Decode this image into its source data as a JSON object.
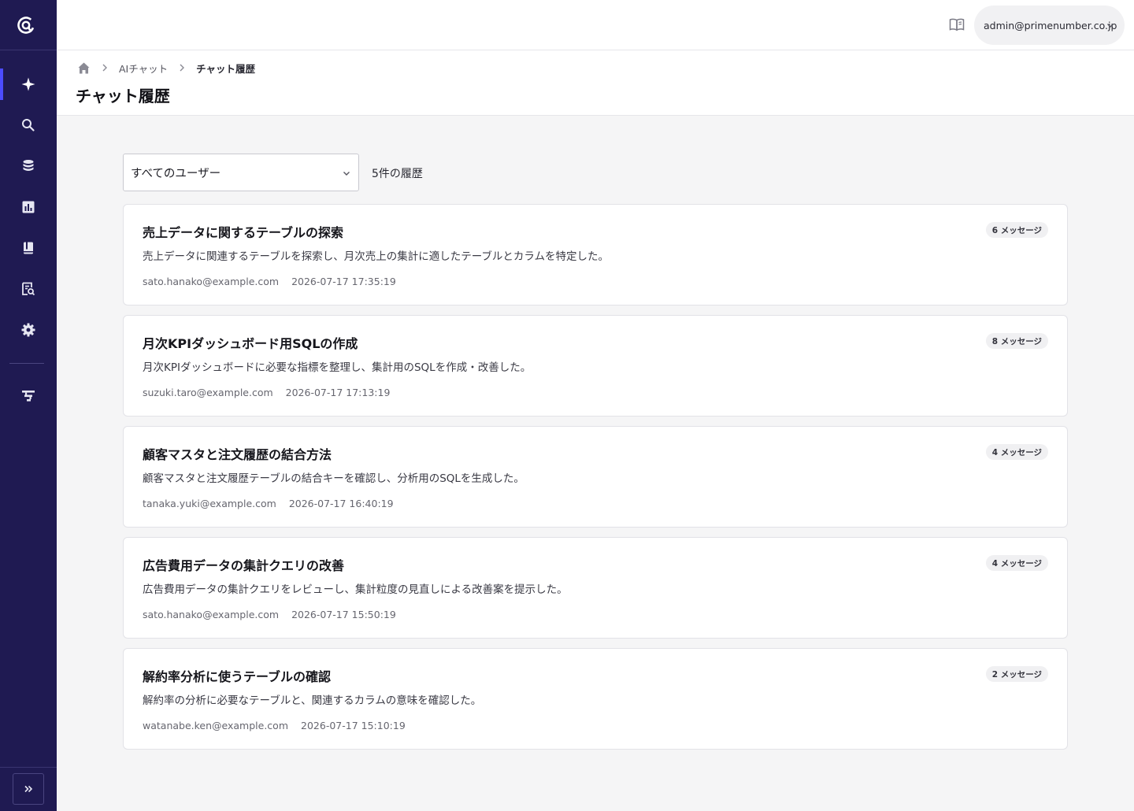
{
  "header": {
    "account_email": "admin@primenumber.co.jp"
  },
  "breadcrumb": {
    "parent": "AIチャット",
    "current": "チャット履歴"
  },
  "page": {
    "title": "チャット履歴"
  },
  "filter": {
    "selected": "すべてのユーザー",
    "count_text": "5件の履歴"
  },
  "sidebar": {
    "items": [
      {
        "icon": "sparkle-icon",
        "active": true
      },
      {
        "icon": "search-icon",
        "active": false
      },
      {
        "icon": "database-icon",
        "active": false
      },
      {
        "icon": "chart-icon",
        "active": false
      },
      {
        "icon": "book-icon",
        "active": false
      },
      {
        "icon": "document-search-icon",
        "active": false
      },
      {
        "icon": "gear-icon",
        "active": false
      },
      {
        "icon": "pipeline-icon",
        "active": false
      }
    ]
  },
  "history": [
    {
      "title": "売上データに関するテーブルの探索",
      "summary": "売上データに関連するテーブルを探索し、月次売上の集計に適したテーブルとカラムを特定した。",
      "user": "sato.hanako@example.com",
      "timestamp": "2026-07-17 17:35:19",
      "messages": "6 メッセージ"
    },
    {
      "title": "月次KPIダッシュボード用SQLの作成",
      "summary": "月次KPIダッシュボードに必要な指標を整理し、集計用のSQLを作成・改善した。",
      "user": "suzuki.taro@example.com",
      "timestamp": "2026-07-17 17:13:19",
      "messages": "8 メッセージ"
    },
    {
      "title": "顧客マスタと注文履歴の結合方法",
      "summary": "顧客マスタと注文履歴テーブルの結合キーを確認し、分析用のSQLを生成した。",
      "user": "tanaka.yuki@example.com",
      "timestamp": "2026-07-17 16:40:19",
      "messages": "4 メッセージ"
    },
    {
      "title": "広告費用データの集計クエリの改善",
      "summary": "広告費用データの集計クエリをレビューし、集計粒度の見直しによる改善案を提示した。",
      "user": "sato.hanako@example.com",
      "timestamp": "2026-07-17 15:50:19",
      "messages": "4 メッセージ"
    },
    {
      "title": "解約率分析に使うテーブルの確認",
      "summary": "解約率の分析に必要なテーブルと、関連するカラムの意味を確認した。",
      "user": "watanabe.ken@example.com",
      "timestamp": "2026-07-17 15:10:19",
      "messages": "2 メッセージ"
    }
  ],
  "colors": {
    "sidebar_bg": "#1f1a52",
    "active_indicator": "#4c4cff",
    "page_bg": "#f5f5f6"
  }
}
